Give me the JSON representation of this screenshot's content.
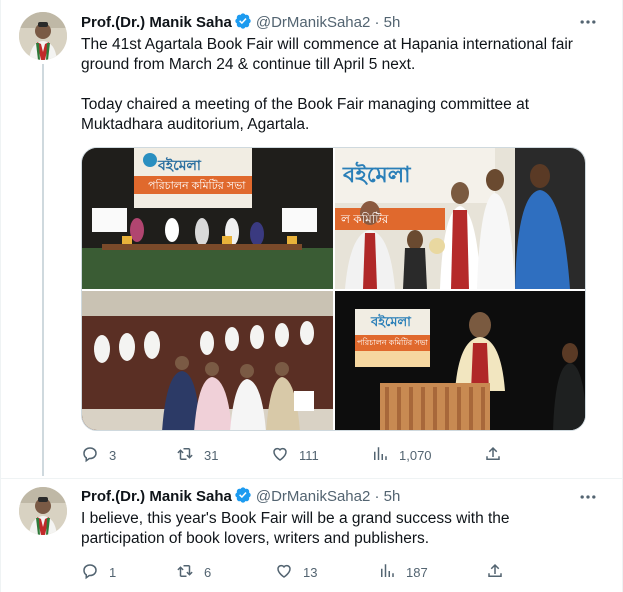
{
  "tweets": [
    {
      "author_name": "Prof.(Dr.) Manik Saha",
      "handle": "@DrManikSaha2",
      "dot": "·",
      "time": "5h",
      "text_p1": "The 41st Agartala Book Fair will commence at Hapania international fair ground from March 24 & continue till April 5 next.",
      "text_p2": "Today chaired a meeting of the Book Fair managing committee at Muktadhara auditorium, Agartala.",
      "media": {
        "photo1_banner": "বইমেলা",
        "photo1_sub": "পরিচালন কমিটির সভা",
        "photo2_banner": "বইমেলা",
        "photo2_sub": "ল কমিটির",
        "photo4_banner": "বইমেলা",
        "photo4_sub": "পরিচালন কমিটির সভা"
      },
      "replies": "3",
      "retweets": "31",
      "likes": "111",
      "views": "1,070"
    },
    {
      "author_name": "Prof.(Dr.) Manik Saha",
      "handle": "@DrManikSaha2",
      "dot": "·",
      "time": "5h",
      "text_p1": "I believe, this year's Book Fair will be a grand success with the participation of book lovers, writers and publishers.",
      "replies": "1",
      "retweets": "6",
      "likes": "13",
      "views": "187"
    }
  ],
  "colors": {
    "verified": "#1d9bf0",
    "muted": "#536471",
    "text": "#0f1419"
  },
  "icons": [
    "more-icon",
    "verified-badge-icon",
    "reply-icon",
    "retweet-icon",
    "like-icon",
    "views-icon",
    "share-icon"
  ]
}
